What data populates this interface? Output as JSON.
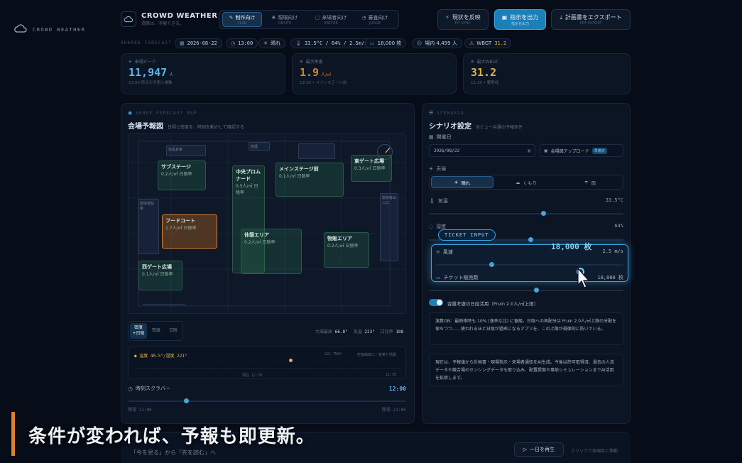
{
  "app": {
    "logo_text": "CROWD WEATHER",
    "brand": "CROWD WEATHER",
    "brand_version": "v2",
    "brand_sub": "混雑は、予報できる。"
  },
  "nav_tabs": [
    {
      "label": "制作向け",
      "sub": "PLAN",
      "active": true
    },
    {
      "label": "現場向け",
      "sub": "ONSITE",
      "active": false
    },
    {
      "label": "来場者向け",
      "sub": "VISITOR",
      "active": false
    },
    {
      "label": "審査向け",
      "sub": "JUDGE",
      "active": false
    }
  ],
  "actions": {
    "reflect": {
      "label": "現状を反映",
      "sub": "FIT SYNC"
    },
    "order": {
      "label": "指示を出力",
      "sub": "指示を出力"
    },
    "export": {
      "label": "計画書をエクスポート",
      "sub": "PDF EXPORT"
    }
  },
  "status_bar": {
    "label": "SHARED FORECAST",
    "date": "2026-08-22",
    "time": "13:00",
    "weather": "晴れ",
    "conditions": "33.5°C / 64% / 2.5m/s",
    "tickets": "18,000 枚",
    "onsite": "場内 4,499 人",
    "wbgt_label": "WBGT",
    "wbgt": "31.2"
  },
  "kpis": [
    {
      "label": "来場ピーク",
      "value": "11,947",
      "unit": "人",
      "note": "13:00 時点の予測入場数"
    },
    {
      "label": "最大密度",
      "value": "1.9",
      "unit": "人/㎡",
      "note": "13:30 • メインステージ前"
    },
    {
      "label": "最大WBGT",
      "value": "31.2",
      "unit": "",
      "note": "11:30 • 要警戒"
    }
  ],
  "map": {
    "eyebrow": "VENUE FORECAST MAP",
    "title": "会場予報図",
    "subtitle": "日程と密度を、時刻を動かして確認する",
    "zones": [
      {
        "name": "サブステージ",
        "value": "0.2人/㎡ 日陰率"
      },
      {
        "name": "中央プロムナード",
        "value": "0.5人/㎡ 日陰率"
      },
      {
        "name": "メインステージ前",
        "value": "0.1人/㎡ 日陰率"
      },
      {
        "name": "東ゲート広場",
        "value": "0.3人/㎡ 日陰率"
      },
      {
        "name": "フードコート",
        "value": "1.7人/㎡ 日陰率"
      },
      {
        "name": "休憩エリア",
        "value": "0.2人/㎡ 日陰率"
      },
      {
        "name": "物販エリア",
        "value": "0.2人/㎡ 日陰率"
      },
      {
        "name": "西ゲート広場",
        "value": "0.1人/㎡ 日陰率"
      }
    ],
    "boxes": [
      {
        "name": "仮設倉庫"
      },
      {
        "name": "救護"
      },
      {
        "name": "関係者駐車"
      },
      {
        "name": "関係者出入口"
      }
    ],
    "view_tabs": [
      "密度\n+日陰",
      "密度",
      "日陰"
    ],
    "stats": {
      "max_density_label": "大域最高",
      "max_density": "66.8°",
      "temp_label": "気温",
      "temp": "223°",
      "gate_label": "口比率",
      "gate": "108"
    }
  },
  "timeline": {
    "legend": "● 温度 40.5°/湿度 221°",
    "right_labels": [
      "221 TMAX",
      "密接曲線に一番乗り情報"
    ],
    "now_label": "現在 12:30",
    "end_label": "11:30"
  },
  "scrubber": {
    "label": "時刻スクラバー",
    "time": "12:00",
    "start": "開場 11:00",
    "end": "閉場 21:00"
  },
  "scenario": {
    "eyebrow": "SCENARIO",
    "title": "シナリオ設定",
    "subtitle": "全ビュー共通の予報条件",
    "date_label": "開催日",
    "date_value": "2026/08/22",
    "upload_label": "会場図アップロード",
    "upload_badge": "準備済",
    "weather_label": "天候",
    "weather_options": [
      "晴れ",
      "くもり",
      "雨"
    ],
    "temp_label": "気温",
    "temp_value": "33.5°C",
    "humidity_label": "湿度",
    "humidity_value": "64%",
    "wind_label": "風速",
    "wind_value": "2.5 m/s",
    "ticket_label": "チケット販売数",
    "ticket_value": "18,000 枚",
    "ticket_tooltip": "TICKET INPUT",
    "ticket_overlay": "18,000 枚",
    "fruin_label": "容量考慮の日陰活用（Fruin 2.0人/㎡上限）",
    "fruin_desc": "演算ON：最熱帯時も 10% (逸率な比) に留級。日陰への再配分は Fruin 2.0人/㎡上限の分配を保ちつつ……使われるほど日陰が過密になるアプリを、この上限が規律的に防いでいる。",
    "fruin_highlight": "10%",
    "note": "現在は、予報値から計画書・現場指示・来場者通知をAI生成。今後は許可取得済、過去の人流データや競合場のセンシングデータも取り込み、配置提案や事前シミュレーションまでAI活用を拡張します。"
  },
  "caption": "条件が変われば、予報も即更新。",
  "footer": {
    "left_text": "「今を見る」から「先を読む」へ",
    "replay_label": "一日を再生",
    "right_text": "クリックで各項目に移動"
  },
  "colors": {
    "accent": "#3aa6e0",
    "orange": "#d9812d",
    "gold": "#e0b24a",
    "green": "#2f8a62"
  }
}
